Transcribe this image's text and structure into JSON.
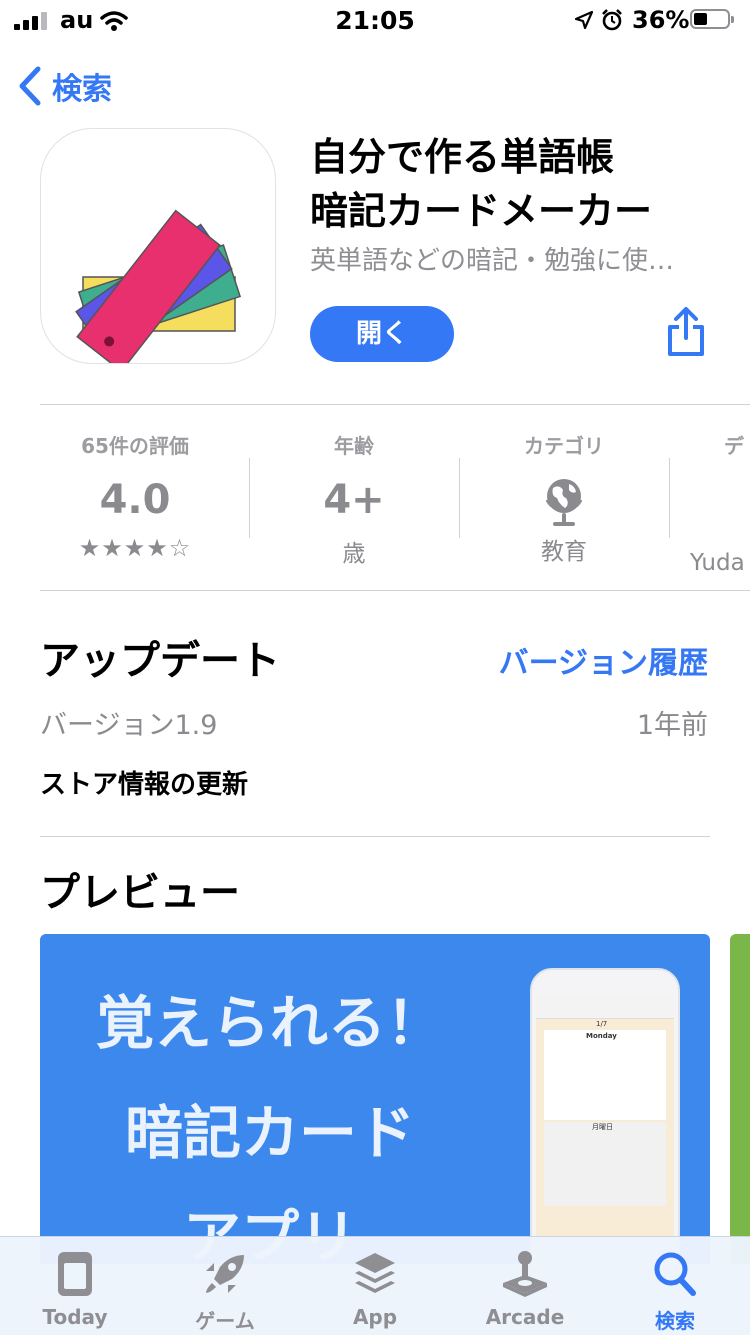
{
  "status": {
    "carrier": "au",
    "time": "21:05",
    "battery": "36%"
  },
  "nav": {
    "back_label": "検索"
  },
  "app": {
    "title_line1": "自分で作る単語帳",
    "title_line2": "暗記カードメーカー",
    "subtitle": "英単語などの暗記・勉強に使…",
    "open_label": "開く"
  },
  "info": {
    "ratings": {
      "label": "65件の評価",
      "value": "4.0",
      "stars": "★★★★☆"
    },
    "age": {
      "label": "年齢",
      "value": "4+",
      "unit": "歳"
    },
    "category": {
      "label": "カテゴリ",
      "value": "教育"
    },
    "developer": {
      "label": "デ",
      "value": "Yuda"
    }
  },
  "update": {
    "heading": "アップデート",
    "history_link": "バージョン履歴",
    "version": "バージョン1.9",
    "ago": "1年前",
    "notes": "ストア情報の更新"
  },
  "preview": {
    "heading": "プレビュー",
    "line1": "覚えられる！",
    "line2": "暗記カード",
    "line3": "アプリ",
    "phone": {
      "counter": "1/7",
      "front": "Monday",
      "back": "月曜日"
    }
  },
  "tabs": [
    {
      "label": "Today",
      "icon": "today-icon"
    },
    {
      "label": "ゲーム",
      "icon": "rocket-icon"
    },
    {
      "label": "App",
      "icon": "layers-icon"
    },
    {
      "label": "Arcade",
      "icon": "joystick-icon"
    },
    {
      "label": "検索",
      "icon": "search-icon"
    }
  ],
  "colors": {
    "accent": "#3478f6",
    "preview_bg": "#3c88ec"
  }
}
